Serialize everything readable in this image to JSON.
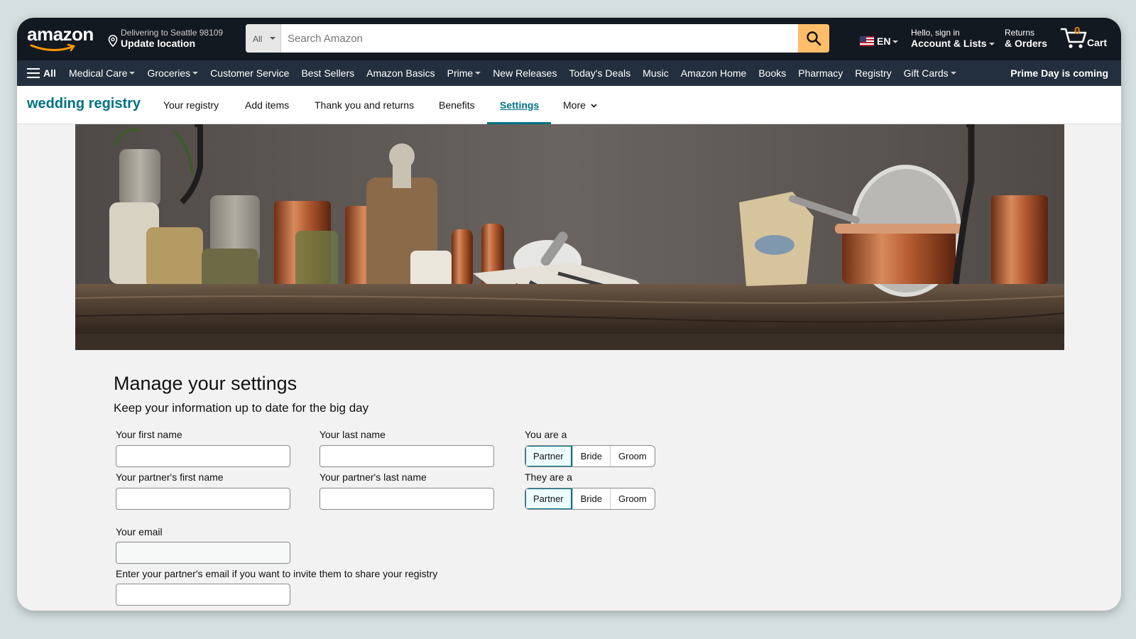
{
  "header": {
    "logo_text": "amazon",
    "deliver_line1": "Delivering to Seattle 98109",
    "deliver_line2": "Update location",
    "search_category": "All",
    "search_placeholder": "Search Amazon",
    "language": "EN",
    "account_line1": "Hello, sign in",
    "account_line2": "Account & Lists",
    "returns_line1": "Returns",
    "returns_line2": "& Orders",
    "cart_count": "0",
    "cart_label": "Cart"
  },
  "nav": {
    "all_label": "All",
    "items": [
      "Medical Care",
      "Groceries",
      "Customer Service",
      "Best Sellers",
      "Amazon Basics",
      "Prime",
      "New Releases",
      "Today's Deals",
      "Music",
      "Amazon Home",
      "Books",
      "Pharmacy",
      "Registry",
      "Gift Cards"
    ],
    "promo": "Prime Day is coming"
  },
  "registry_nav": {
    "brand": "wedding registry",
    "tabs": [
      "Your registry",
      "Add items",
      "Thank you and returns",
      "Benefits",
      "Settings",
      "More"
    ],
    "active_tab": "Settings"
  },
  "settings": {
    "title": "Manage your settings",
    "subtitle": "Keep your information up to date for the big day",
    "first_name_label": "Your first name",
    "last_name_label": "Your last name",
    "partner_first_label": "Your partner's first name",
    "partner_last_label": "Your partner's last name",
    "you_are_label": "You are a",
    "they_are_label": "They are a",
    "role_options": [
      "Partner",
      "Bride",
      "Groom"
    ],
    "you_are_selected": "Partner",
    "they_are_selected": "Partner",
    "email_label": "Your email",
    "partner_email_label": "Enter your partner's email if you want to invite them to share your registry",
    "first_name_value": "",
    "last_name_value": "",
    "partner_first_value": "",
    "partner_last_value": "",
    "email_value": "",
    "partner_email_value": ""
  },
  "colors": {
    "topbar": "#131921",
    "navbar": "#232f3e",
    "accent": "#007185",
    "search_button": "#febd69",
    "cart_count": "#f08804"
  }
}
